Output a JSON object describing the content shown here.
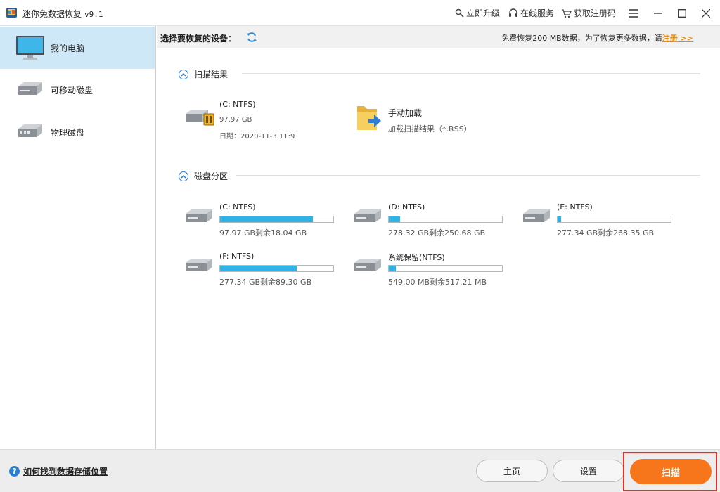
{
  "window": {
    "title": "迷你兔数据恢复",
    "version": "v9.1",
    "links": {
      "upgrade": "立即升级",
      "service": "在线服务",
      "register": "获取注册码"
    }
  },
  "sidebar": {
    "items": [
      {
        "label": "我的电脑",
        "icon": "monitor-icon",
        "active": true
      },
      {
        "label": "可移动磁盘",
        "icon": "drive-icon",
        "active": false
      },
      {
        "label": "物理磁盘",
        "icon": "physical-disk-icon",
        "active": false
      }
    ]
  },
  "main": {
    "header": {
      "title": "选择要恢复的设备：",
      "promo_text": "免费恢复200 MB数据，为了恢复更多数据，请",
      "promo_link": "注册 >>"
    },
    "scan_results": {
      "title": "扫描结果",
      "item": {
        "name": "(C: NTFS)",
        "size": "97.97 GB",
        "date": "日期：2020-11-3 11:9"
      },
      "manual_load": {
        "name": "手动加载",
        "desc": "加载扫描结果（*.RSS）"
      }
    },
    "partitions": {
      "title": "磁盘分区",
      "items": [
        {
          "name": "(C: NTFS)",
          "info": "97.97 GB剩余18.04 GB",
          "used_fraction": 0.82
        },
        {
          "name": "(D: NTFS)",
          "info": "278.32 GB剩余250.68 GB",
          "used_fraction": 0.1
        },
        {
          "name": "(E: NTFS)",
          "info": "277.34 GB剩余268.35 GB",
          "used_fraction": 0.03
        },
        {
          "name": "(F: NTFS)",
          "info": "277.34 GB剩余89.30 GB",
          "used_fraction": 0.68
        },
        {
          "name": "系统保留(NTFS)",
          "info": "549.00 MB剩余517.21 MB",
          "used_fraction": 0.06
        }
      ]
    }
  },
  "footer": {
    "help_text": "如何找到数据存储位置",
    "home": "主页",
    "settings": "设置",
    "scan": "扫描"
  },
  "colors": {
    "accent": "#f7761c",
    "bar": "#2fb2e6",
    "highlight": "#e0302a",
    "active_bg": "#cfe8f7"
  }
}
